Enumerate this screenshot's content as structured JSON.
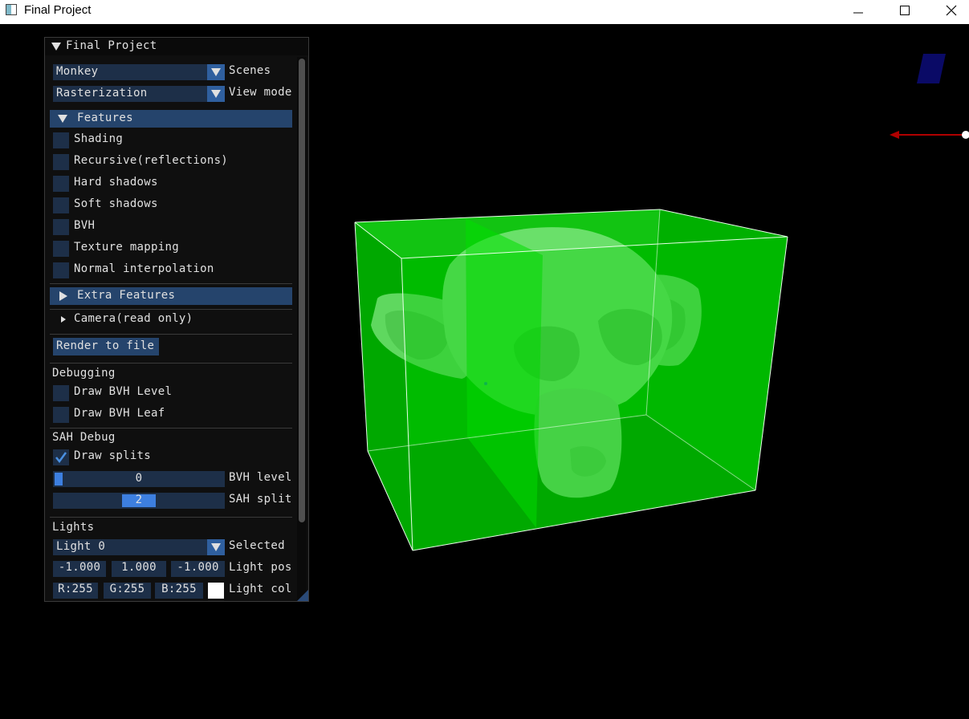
{
  "window": {
    "title": "Final Project"
  },
  "panel": {
    "title": "Final Project",
    "scene_combo": {
      "value": "Monkey",
      "label": "Scenes"
    },
    "view_mode_combo": {
      "value": "Rasterization",
      "label": "View mode"
    },
    "features_header": "Features",
    "features": [
      {
        "label": "Shading",
        "checked": false
      },
      {
        "label": "Recursive(reflections)",
        "checked": false
      },
      {
        "label": "Hard shadows",
        "checked": false
      },
      {
        "label": "Soft shadows",
        "checked": false
      },
      {
        "label": "BVH",
        "checked": false
      },
      {
        "label": "Texture mapping",
        "checked": false
      },
      {
        "label": "Normal interpolation",
        "checked": false
      }
    ],
    "extra_features_header": "Extra Features",
    "camera_tree": "Camera(read only)",
    "render_button": "Render to file",
    "debugging": {
      "title": "Debugging",
      "draw_bvh_level": {
        "label": "Draw BVH Level",
        "checked": false
      },
      "draw_bvh_leaf": {
        "label": "Draw BVH Leaf",
        "checked": false
      }
    },
    "sah_debug": {
      "title": "SAH Debug",
      "draw_splits": {
        "label": "Draw splits",
        "checked": true
      },
      "bvh_level": {
        "value": "0",
        "label": "BVH level"
      },
      "sah_split": {
        "value": "2",
        "label": "SAH split"
      }
    },
    "lights": {
      "title": "Lights",
      "selected_combo": {
        "value": "Light 0",
        "label": "Selected"
      },
      "position": {
        "x": "-1.000",
        "y": "1.000",
        "z": "-1.000",
        "label": "Light pos"
      },
      "color": {
        "r": "R:255",
        "g": "G:255",
        "b": "B:255",
        "label": "Light col",
        "swatch": "#ffffff"
      }
    }
  },
  "colors": {
    "panel_bg": "#0f0f0f",
    "frame_bg": "#1d2f48",
    "header_bg": "#25446c",
    "accent": "#3d7fe0",
    "checkmark": "#4a90e2",
    "split_green": "#00cc00"
  }
}
